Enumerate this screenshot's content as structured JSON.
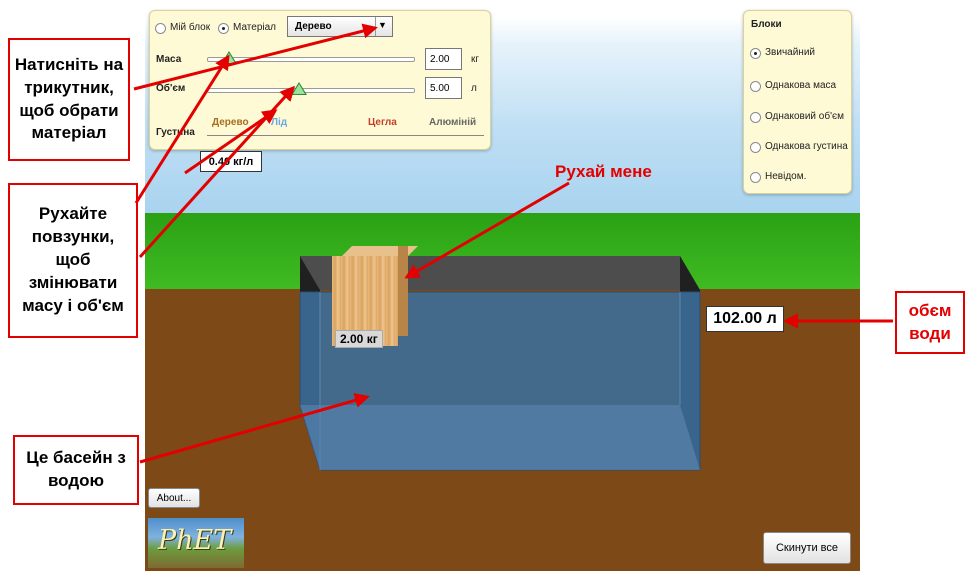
{
  "material_panel": {
    "my_block_label": "Мій блок",
    "material_label": "Матеріал",
    "material_selected": "Дерево",
    "mass_label": "Маса",
    "mass_value": "2.00",
    "mass_unit": "кг",
    "mass_fraction": 0.02,
    "volume_label": "Об'єм",
    "volume_value": "5.00",
    "volume_unit": "л",
    "volume_fraction": 0.42,
    "density_label": "Густина",
    "density_ticks": [
      {
        "label": "Дерево",
        "color": "#a66e1e"
      },
      {
        "label": "Лід",
        "color": "#6aa8e0"
      },
      {
        "label": "Цегла",
        "color": "#c2402a"
      },
      {
        "label": "Алюміній",
        "color": "#666666"
      }
    ],
    "density_readout": "0.40 кг/л"
  },
  "blocks_panel": {
    "title": "Блоки",
    "options": [
      "Звичайний",
      "Однакова маса",
      "Однаковий об'єм",
      "Однакова густина",
      "Невідом."
    ],
    "selected_index": 0
  },
  "block_mass_label": "2.00 кг",
  "water_volume_label": "102.00 л",
  "drag_hint": "Рухай мене",
  "callouts": {
    "triangle": "Натисніть на трикутник, щоб обрати матеріал",
    "sliders": "Рухайте повзунки, щоб змінювати масу і об'єм",
    "pool": "Це басейн з водою",
    "water_volume": "обєм води"
  },
  "buttons": {
    "about": "About...",
    "reset": "Скинути все"
  },
  "logo_text": "PhET",
  "colors": {
    "arrow": "#e30000",
    "panel": "#fffad6",
    "grass": "#33a91a",
    "ground": "#7c4917",
    "water": "#3c6e9c"
  }
}
